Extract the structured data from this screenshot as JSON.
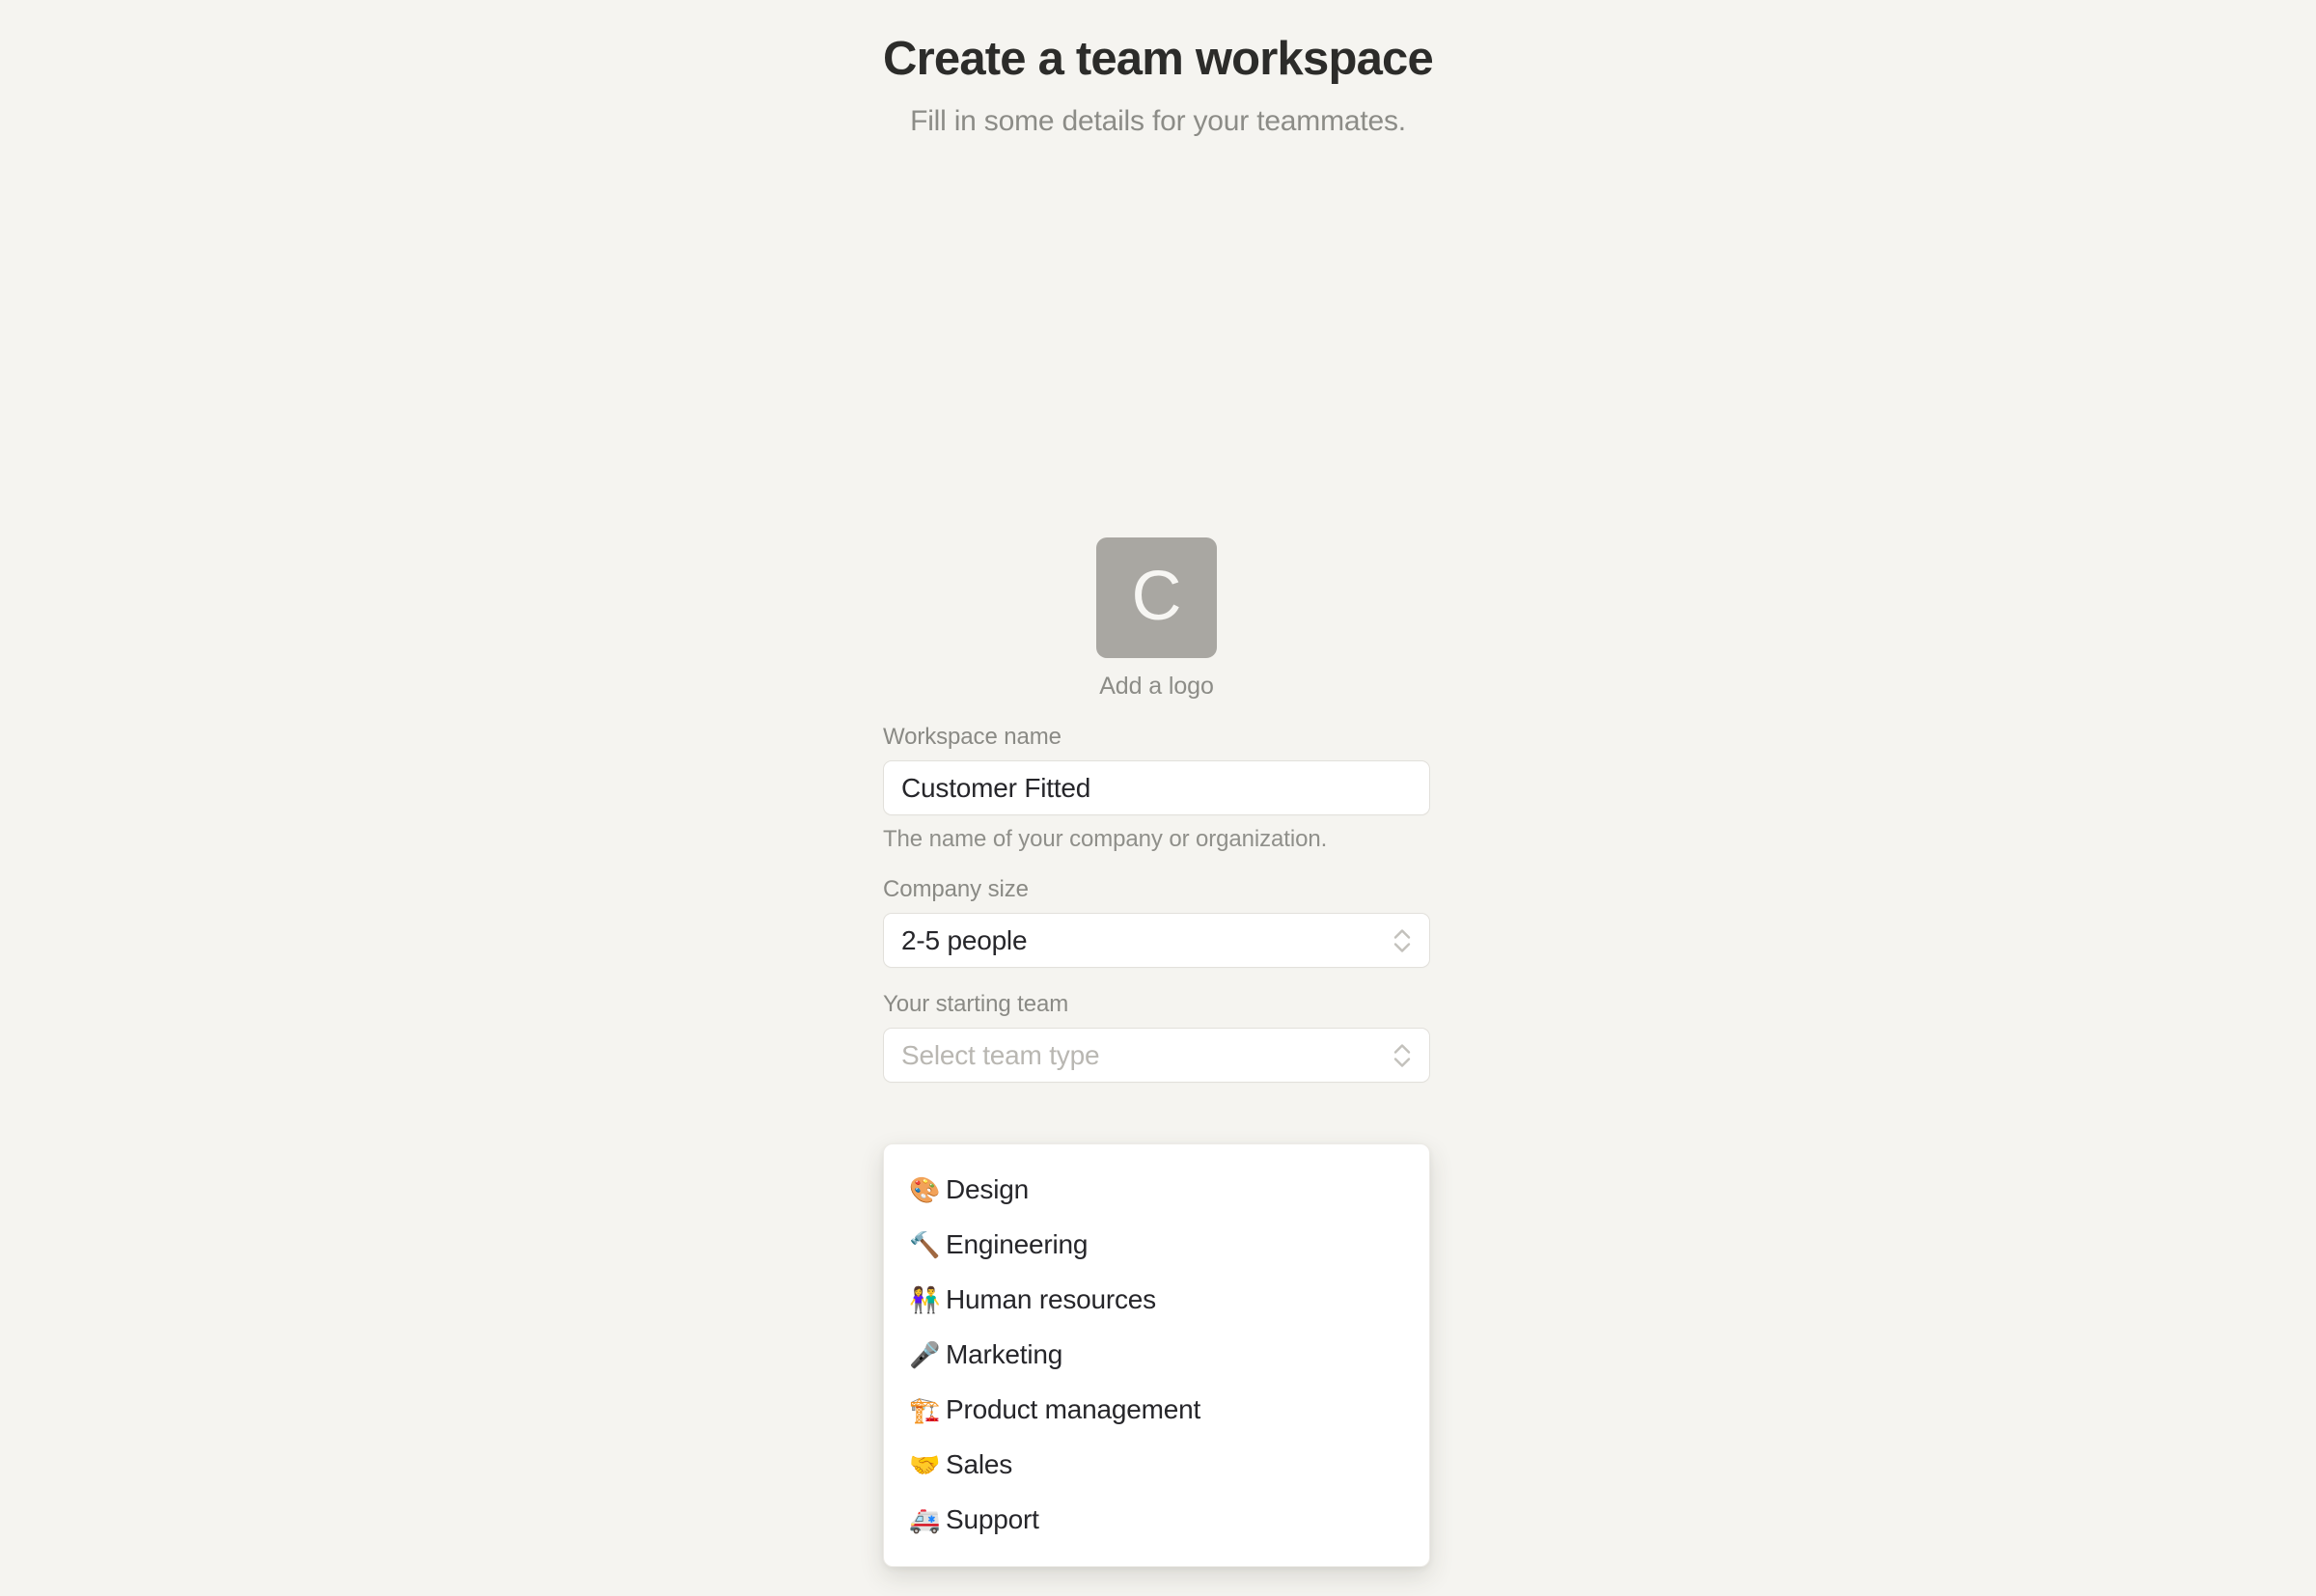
{
  "header": {
    "title": "Create a team workspace",
    "subtitle": "Fill in some details for your teammates."
  },
  "logo": {
    "letter": "C",
    "caption": "Add a logo",
    "tile_color": "#a9a7a2",
    "letter_color": "#f7f6f3"
  },
  "fields": {
    "workspace_name": {
      "label": "Workspace name",
      "value": "Customer Fitted",
      "help": "The name of your company or organization."
    },
    "company_size": {
      "label": "Company size",
      "value": "2-5 people"
    },
    "starting_team": {
      "label": "Your starting team",
      "placeholder": "Select team type",
      "value": ""
    }
  },
  "dropdown": {
    "open": true,
    "options": [
      {
        "emoji": "🎨",
        "emoji_name": "artist-palette-icon",
        "label": "Design"
      },
      {
        "emoji": "🔨",
        "emoji_name": "hammer-icon",
        "label": "Engineering"
      },
      {
        "emoji": "👫",
        "emoji_name": "man-and-woman-holding-hands-icon",
        "label": "Human resources"
      },
      {
        "emoji": "🎤",
        "emoji_name": "microphone-icon",
        "label": "Marketing"
      },
      {
        "emoji": "🏗️",
        "emoji_name": "building-construction-icon",
        "label": "Product management"
      },
      {
        "emoji": "🤝",
        "emoji_name": "handshake-icon",
        "label": "Sales"
      },
      {
        "emoji": "🚑",
        "emoji_name": "ambulance-icon",
        "label": "Support"
      }
    ]
  },
  "theme": {
    "background": "#f5f4f0",
    "text_primary": "#26262a",
    "text_muted": "#8c8c87",
    "border": "#e2e0db",
    "surface": "#ffffff"
  }
}
